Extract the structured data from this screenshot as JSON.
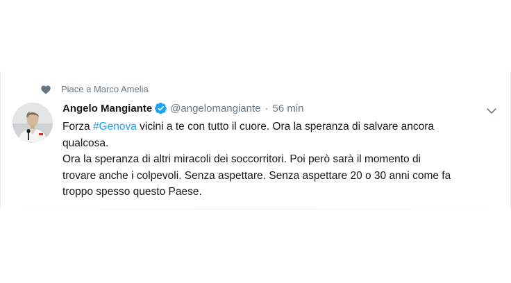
{
  "context": {
    "label": "Piace a Marco Amelia",
    "icon": "heart-icon"
  },
  "tweet": {
    "author_name": "Angelo Mangiante",
    "verified": true,
    "handle": "@angelomangiante",
    "separator": "·",
    "time": "56 min",
    "lines": [
      {
        "before": "Forza ",
        "hashtag": "#Genova",
        "after": " vicini a te con tutto il cuore. Ora la speranza di salvare ancora"
      },
      {
        "text": "qualcosa."
      },
      {
        "text": "Ora la speranza di altri miracoli dei soccorritori. Poi però sarà il momento di"
      },
      {
        "text": "trovare anche i colpevoli. Senza aspettare. Senza aspettare 20 o 30 anni come fa"
      },
      {
        "text": "troppo spesso questo Paese."
      }
    ]
  },
  "colors": {
    "text": "#14171a",
    "secondary": "#657786",
    "link": "#1da1f2",
    "verified": "#1da1f2",
    "heart": "#657786"
  },
  "icons": {
    "verified": "verified-badge-icon",
    "menu": "chevron-down-icon"
  }
}
